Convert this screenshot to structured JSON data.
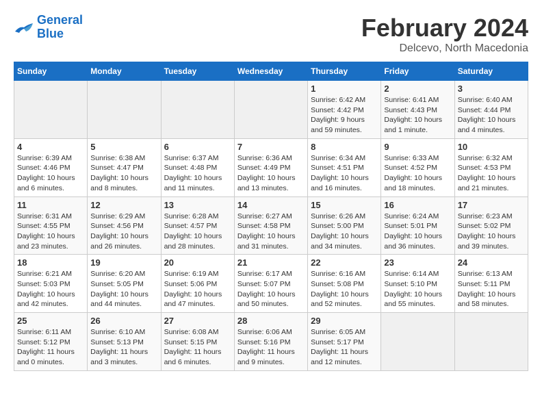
{
  "header": {
    "logo_line1": "General",
    "logo_line2": "Blue",
    "month_title": "February 2024",
    "location": "Delcevo, North Macedonia"
  },
  "weekdays": [
    "Sunday",
    "Monday",
    "Tuesday",
    "Wednesday",
    "Thursday",
    "Friday",
    "Saturday"
  ],
  "weeks": [
    [
      {
        "day": "",
        "info": ""
      },
      {
        "day": "",
        "info": ""
      },
      {
        "day": "",
        "info": ""
      },
      {
        "day": "",
        "info": ""
      },
      {
        "day": "1",
        "info": "Sunrise: 6:42 AM\nSunset: 4:42 PM\nDaylight: 9 hours\nand 59 minutes."
      },
      {
        "day": "2",
        "info": "Sunrise: 6:41 AM\nSunset: 4:43 PM\nDaylight: 10 hours\nand 1 minute."
      },
      {
        "day": "3",
        "info": "Sunrise: 6:40 AM\nSunset: 4:44 PM\nDaylight: 10 hours\nand 4 minutes."
      }
    ],
    [
      {
        "day": "4",
        "info": "Sunrise: 6:39 AM\nSunset: 4:46 PM\nDaylight: 10 hours\nand 6 minutes."
      },
      {
        "day": "5",
        "info": "Sunrise: 6:38 AM\nSunset: 4:47 PM\nDaylight: 10 hours\nand 8 minutes."
      },
      {
        "day": "6",
        "info": "Sunrise: 6:37 AM\nSunset: 4:48 PM\nDaylight: 10 hours\nand 11 minutes."
      },
      {
        "day": "7",
        "info": "Sunrise: 6:36 AM\nSunset: 4:49 PM\nDaylight: 10 hours\nand 13 minutes."
      },
      {
        "day": "8",
        "info": "Sunrise: 6:34 AM\nSunset: 4:51 PM\nDaylight: 10 hours\nand 16 minutes."
      },
      {
        "day": "9",
        "info": "Sunrise: 6:33 AM\nSunset: 4:52 PM\nDaylight: 10 hours\nand 18 minutes."
      },
      {
        "day": "10",
        "info": "Sunrise: 6:32 AM\nSunset: 4:53 PM\nDaylight: 10 hours\nand 21 minutes."
      }
    ],
    [
      {
        "day": "11",
        "info": "Sunrise: 6:31 AM\nSunset: 4:55 PM\nDaylight: 10 hours\nand 23 minutes."
      },
      {
        "day": "12",
        "info": "Sunrise: 6:29 AM\nSunset: 4:56 PM\nDaylight: 10 hours\nand 26 minutes."
      },
      {
        "day": "13",
        "info": "Sunrise: 6:28 AM\nSunset: 4:57 PM\nDaylight: 10 hours\nand 28 minutes."
      },
      {
        "day": "14",
        "info": "Sunrise: 6:27 AM\nSunset: 4:58 PM\nDaylight: 10 hours\nand 31 minutes."
      },
      {
        "day": "15",
        "info": "Sunrise: 6:26 AM\nSunset: 5:00 PM\nDaylight: 10 hours\nand 34 minutes."
      },
      {
        "day": "16",
        "info": "Sunrise: 6:24 AM\nSunset: 5:01 PM\nDaylight: 10 hours\nand 36 minutes."
      },
      {
        "day": "17",
        "info": "Sunrise: 6:23 AM\nSunset: 5:02 PM\nDaylight: 10 hours\nand 39 minutes."
      }
    ],
    [
      {
        "day": "18",
        "info": "Sunrise: 6:21 AM\nSunset: 5:03 PM\nDaylight: 10 hours\nand 42 minutes."
      },
      {
        "day": "19",
        "info": "Sunrise: 6:20 AM\nSunset: 5:05 PM\nDaylight: 10 hours\nand 44 minutes."
      },
      {
        "day": "20",
        "info": "Sunrise: 6:19 AM\nSunset: 5:06 PM\nDaylight: 10 hours\nand 47 minutes."
      },
      {
        "day": "21",
        "info": "Sunrise: 6:17 AM\nSunset: 5:07 PM\nDaylight: 10 hours\nand 50 minutes."
      },
      {
        "day": "22",
        "info": "Sunrise: 6:16 AM\nSunset: 5:08 PM\nDaylight: 10 hours\nand 52 minutes."
      },
      {
        "day": "23",
        "info": "Sunrise: 6:14 AM\nSunset: 5:10 PM\nDaylight: 10 hours\nand 55 minutes."
      },
      {
        "day": "24",
        "info": "Sunrise: 6:13 AM\nSunset: 5:11 PM\nDaylight: 10 hours\nand 58 minutes."
      }
    ],
    [
      {
        "day": "25",
        "info": "Sunrise: 6:11 AM\nSunset: 5:12 PM\nDaylight: 11 hours\nand 0 minutes."
      },
      {
        "day": "26",
        "info": "Sunrise: 6:10 AM\nSunset: 5:13 PM\nDaylight: 11 hours\nand 3 minutes."
      },
      {
        "day": "27",
        "info": "Sunrise: 6:08 AM\nSunset: 5:15 PM\nDaylight: 11 hours\nand 6 minutes."
      },
      {
        "day": "28",
        "info": "Sunrise: 6:06 AM\nSunset: 5:16 PM\nDaylight: 11 hours\nand 9 minutes."
      },
      {
        "day": "29",
        "info": "Sunrise: 6:05 AM\nSunset: 5:17 PM\nDaylight: 11 hours\nand 12 minutes."
      },
      {
        "day": "",
        "info": ""
      },
      {
        "day": "",
        "info": ""
      }
    ]
  ]
}
